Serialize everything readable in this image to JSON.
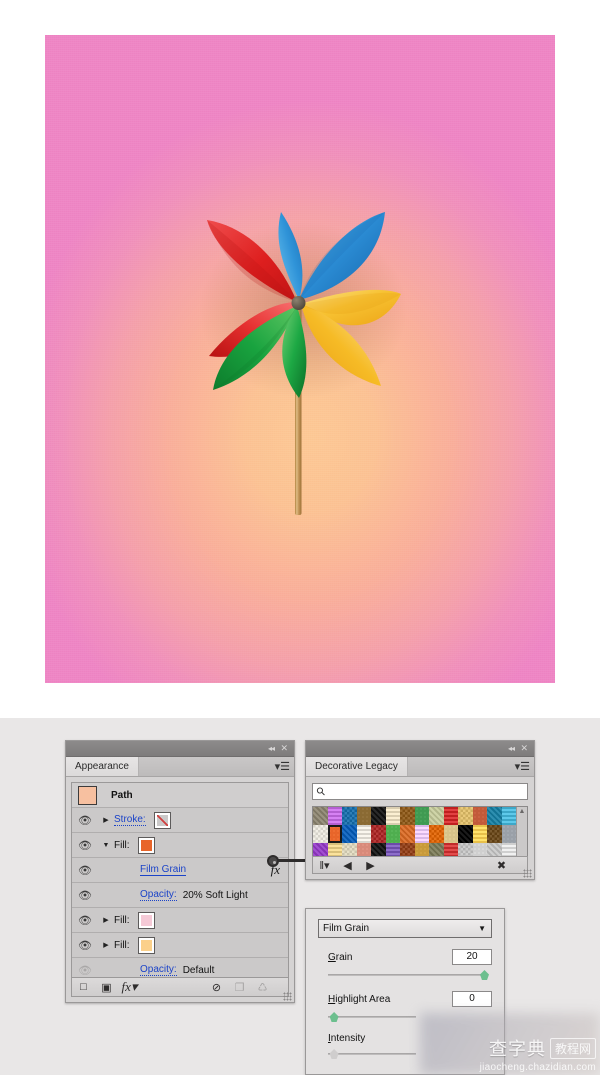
{
  "artwork": {
    "title": "pinwheel-illustration",
    "background_gradient": {
      "center": "#fcc894",
      "mid": "#f6a59e",
      "edge": "#ee85c4"
    },
    "blades": [
      {
        "name": "blade-red",
        "color": "#e02a2a",
        "highlight": "#f25a5a"
      },
      {
        "name": "blade-blue",
        "color": "#1f7ec8",
        "highlight": "#52b4e6"
      },
      {
        "name": "blade-yellow",
        "color": "#f5b51a",
        "highlight": "#fde07a"
      },
      {
        "name": "blade-green",
        "color": "#12a33e",
        "highlight": "#66cc66"
      }
    ],
    "hub_color": "#6b6250",
    "stick_color": "#c49a62"
  },
  "appearance_panel": {
    "title": "Appearance",
    "collapse_icon": "collapse-icon",
    "close_icon": "close-icon",
    "menu_icon": "panel-menu-icon",
    "rows": [
      {
        "kind": "head",
        "label": "Path",
        "swatch": "#f7c0a0",
        "eye": false,
        "tri": "",
        "value": ""
      },
      {
        "kind": "stroke",
        "label": "Stroke:",
        "swatch": "stroke-none",
        "eye": true,
        "tri": "▶",
        "value": ""
      },
      {
        "kind": "fill",
        "label": "Fill:",
        "swatch": "#e8652a",
        "eye": true,
        "tri": "▼",
        "value": ""
      },
      {
        "kind": "effect",
        "label": "Film Grain",
        "swatch": "",
        "eye": true,
        "tri": "",
        "value": "",
        "fx": "fx"
      },
      {
        "kind": "opacity",
        "label": "Opacity:",
        "swatch": "",
        "eye": true,
        "tri": "",
        "value": "20% Soft Light"
      },
      {
        "kind": "fill",
        "label": "Fill:",
        "swatch": "#f5c9d6",
        "eye": true,
        "tri": "▶",
        "value": ""
      },
      {
        "kind": "fill",
        "label": "Fill:",
        "swatch": "#fbd08a",
        "eye": true,
        "tri": "▶",
        "value": ""
      },
      {
        "kind": "opacity",
        "label": "Opacity:",
        "swatch": "",
        "eye": false,
        "tri": "",
        "value": "Default"
      }
    ],
    "footer_icons": [
      {
        "name": "add-new-stroke-button",
        "glyph": "□",
        "dim": false
      },
      {
        "name": "add-new-fill-button",
        "glyph": "▣",
        "dim": false
      },
      {
        "name": "add-new-effect-button",
        "glyph": "fx",
        "dim": false
      },
      {
        "name": "clear-appearance-button",
        "glyph": "⊘",
        "dim": false
      },
      {
        "name": "duplicate-item-button",
        "glyph": "❐",
        "dim": true
      },
      {
        "name": "delete-item-button",
        "glyph": "Ὕ1",
        "dim": true
      }
    ]
  },
  "swatch_panel": {
    "title": "Decorative Legacy",
    "collapse_icon": "collapse-icon",
    "close_icon": "close-icon",
    "menu_icon": "panel-menu-icon",
    "search_placeholder": "",
    "search_value": "",
    "search_icon": "search-icon",
    "selected_index": 15,
    "columns": 14,
    "swatch_colors": [
      "#9a9380",
      "#b45fd1",
      "#2e7fb8",
      "#8a6a33",
      "#2a2a2a",
      "#d9cdb0",
      "#9c6b2f",
      "#3f9a52",
      "#cfd4a8",
      "#c02020",
      "#e9c97a",
      "#c25a3a",
      "#2e8fb0",
      "#3ca7c8",
      "#f2efe6",
      "#e8652a",
      "#1f6fc4",
      "#d8d4cc",
      "#b83b3b",
      "#4fae4f",
      "#e07a3a",
      "#d9b8e8",
      "#e8741a",
      "#d8c48a",
      "#1b1b1b",
      "#e8c04a",
      "#7a5a2f",
      "#9aa0a8",
      "#a24fd1",
      "#d9c07a",
      "#e6e0c8",
      "#d88a7a",
      "#2b2b2b",
      "#6b4ba8",
      "#a0522d",
      "#c89a3a",
      "#8a8a6a",
      "#c02a2a",
      "#cfcfcf",
      "#cfcfcf",
      "#cfcfcf",
      "#cfcfcf",
      "#cfcfcf"
    ],
    "footer_icons": [
      {
        "name": "swatch-libraries-menu-icon",
        "glyph": "‖"
      },
      {
        "name": "load-previous-library-icon",
        "glyph": "◀"
      },
      {
        "name": "load-next-library-icon",
        "glyph": "▶"
      },
      {
        "name": "delete-swatch-icon",
        "glyph": "✗"
      }
    ]
  },
  "filter_dialog": {
    "effect_name": "Film Grain",
    "dropdown_caret": "chevron-down-icon",
    "controls": [
      {
        "name": "grain",
        "label": "Grain",
        "accel": "G",
        "value": "20",
        "percent": 95
      },
      {
        "name": "highlight-area",
        "label": "Highlight Area",
        "accel": "H",
        "value": "0",
        "percent": 3
      },
      {
        "name": "intensity",
        "label": "Intensity",
        "accel": "I",
        "value": "",
        "percent": 3
      }
    ]
  },
  "watermark": {
    "cn": "查字典",
    "box": "教程网",
    "url": "jiaocheng.chazidian.com"
  }
}
